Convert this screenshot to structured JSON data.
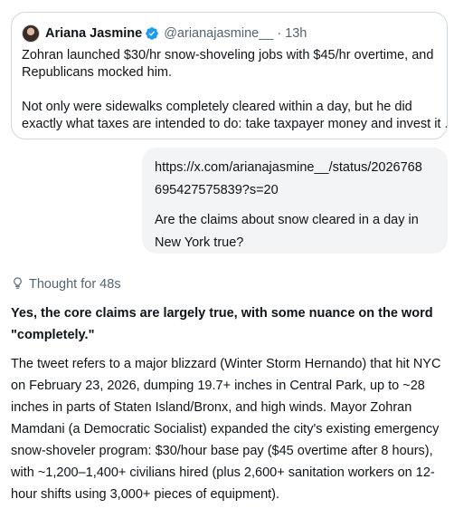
{
  "tweet": {
    "author_name": "Ariana Jasmine",
    "handle": "@arianajasmine__",
    "separator": "·",
    "time": "13h",
    "verified_icon": "verified-badge-icon",
    "verified_color": "#1d9bf0",
    "text_lines_1": [
      "Zohran launched $30/hr snow-shoveling jobs with $45/hr overtime, and",
      "Republicans mocked him."
    ],
    "text_lines_2": [
      "Not only were sidewalks completely cleared within a day, but he did",
      "exactly what taxes are intended to do: take taxpayer money and invest it ..."
    ]
  },
  "user_message": {
    "link_line_1": "https://x.com/arianajasmine__/status/2026768",
    "link_line_2": "695427575839?s=20",
    "question_line_1": "Are the claims about snow cleared in a day in",
    "question_line_2": "New York true?"
  },
  "assistant": {
    "thought_label": "Thought for 48s",
    "thought_icon": "lightbulb-icon",
    "heading_line_1": "Yes, the core claims are largely true, with some nuance on the word",
    "heading_line_2": "\"completely.\"",
    "body_lines": [
      "The tweet refers to a major blizzard (Winter Storm Hernando) that hit NYC",
      "on February 23, 2026, dumping 19.7+ inches in Central Park, up to ~28",
      "inches in parts of Staten Island/Bronx, and high winds. Mayor Zohran",
      "Mamdani (a Democratic Socialist) expanded the city's existing emergency",
      "snow-shoveler program: $30/hour base pay ($45 overtime after 8 hours),",
      "with ~1,200–1,400+ civilians hired (plus 2,600+ sanitation workers on 12-",
      "hour shifts using 3,000+ pieces of equipment)."
    ]
  }
}
